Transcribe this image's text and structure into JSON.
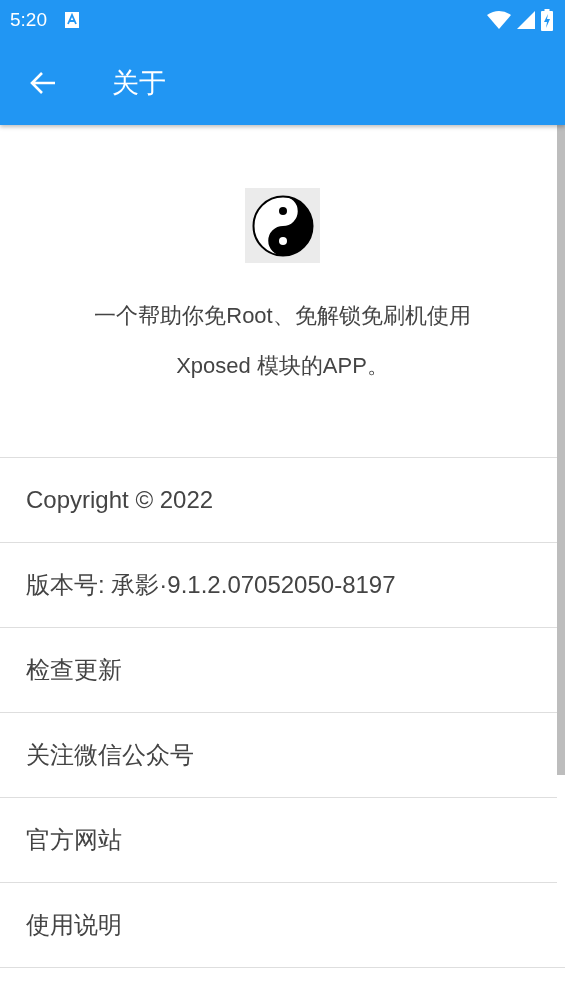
{
  "status_bar": {
    "time": "5:20"
  },
  "toolbar": {
    "title": "关于"
  },
  "about": {
    "description_lines": [
      "一个帮助你免Root、免解锁免刷机使用",
      "Xposed 模块的APP。"
    ]
  },
  "items": [
    {
      "label": "Copyright © 2022"
    },
    {
      "label": "版本号: 承影·9.1.2.07052050-8197"
    },
    {
      "label": "检查更新"
    },
    {
      "label": "关注微信公众号"
    },
    {
      "label": "官方网站"
    },
    {
      "label": "使用说明"
    }
  ]
}
